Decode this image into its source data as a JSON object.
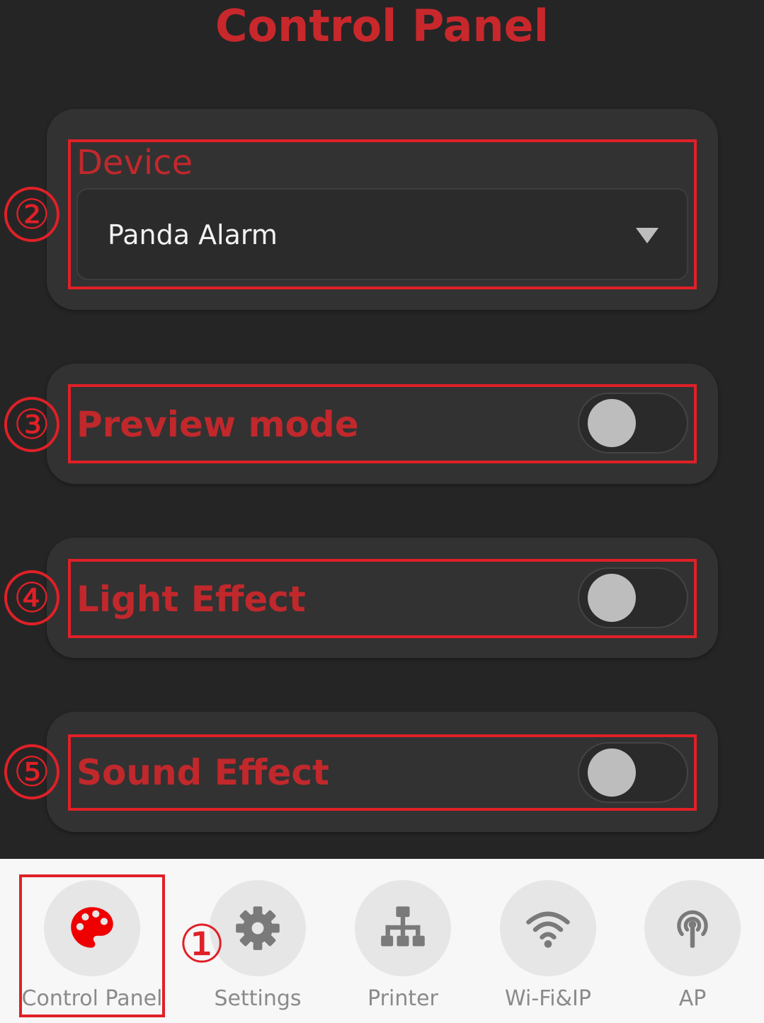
{
  "header": {
    "title": "Control Panel"
  },
  "device": {
    "label": "Device",
    "selected": "Panda Alarm"
  },
  "toggles": [
    {
      "label": "Preview mode",
      "on": false
    },
    {
      "label": "Light Effect",
      "on": false
    },
    {
      "label": "Sound Effect",
      "on": false
    }
  ],
  "annotations": [
    "①",
    "②",
    "③",
    "④",
    "⑤"
  ],
  "nav": [
    {
      "label": "Control Panel",
      "icon": "palette-icon",
      "active": true
    },
    {
      "label": "Settings",
      "icon": "gear-icon",
      "active": false
    },
    {
      "label": "Printer",
      "icon": "network-icon",
      "active": false
    },
    {
      "label": "Wi-Fi&IP",
      "icon": "wifi-icon",
      "active": false
    },
    {
      "label": "AP",
      "icon": "broadcast-icon",
      "active": false
    }
  ],
  "colors": {
    "background": "#252526",
    "card": "#323232",
    "accent": "#c8282c",
    "annotation": "#e02027",
    "active_icon": "#ee0000",
    "inactive_icon": "#7a7a7a",
    "nav_background": "#f7f7f7"
  }
}
